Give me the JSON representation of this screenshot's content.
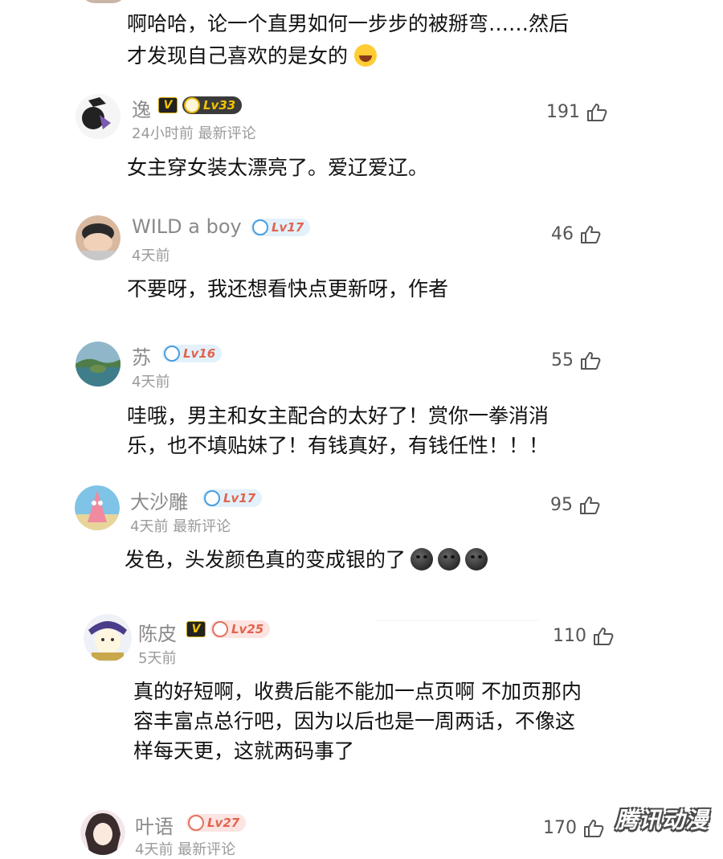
{
  "top_comment": {
    "text_line1": "啊哈哈，论一个直男如何一步步的被掰弯……然后",
    "text_line2": "才发现自己喜欢的是女的",
    "emoji": "laughing-tears-emoji"
  },
  "comments": [
    {
      "name": "逸",
      "vip": "V",
      "level": "Lv33",
      "level_style": "gold",
      "meta": "24小时前 最新评论",
      "likes": "191",
      "text": [
        "女主穿女装太漂亮了。爱辽爱辽。"
      ]
    },
    {
      "name": "WILD a boy",
      "level": "Lv17",
      "level_style": "blue",
      "meta": "4天前",
      "likes": "46",
      "text": [
        "不要呀，我还想看快点更新呀，作者"
      ]
    },
    {
      "name": "苏",
      "level": "Lv16",
      "level_style": "blue",
      "meta": "4天前",
      "likes": "55",
      "text": [
        "哇哦，男主和女主配合的太好了！赏你一拳消消",
        "乐，也不填贴妹了！有钱真好，有钱任性！！！"
      ]
    },
    {
      "name": "大沙雕",
      "level": "Lv17",
      "level_style": "blue",
      "meta": "4天前 最新评论",
      "likes": "95",
      "text": [
        "发色，头发颜色真的变成银的了"
      ],
      "emoji": "new-moon-face-emoji"
    },
    {
      "name": "陈皮",
      "vip": "V",
      "level": "Lv25",
      "level_style": "red",
      "meta": "5天前",
      "likes": "110",
      "text": [
        "真的好短啊，收费后能不能加一点页啊 不加页那内",
        "容丰富点总行吧，因为以后也是一周两话，不像这",
        "样每天更，这就两码事了"
      ]
    },
    {
      "name": "叶语",
      "level": "Lv27",
      "level_style": "red",
      "meta": "4天前 最新评论",
      "likes": "170"
    }
  ],
  "watermark": "腾讯动漫",
  "colors": {
    "name_gray": "#8a8a8a",
    "meta_gray": "#9a9a9a",
    "level_red": "#e2634d",
    "vip_gold": "#f4c400"
  }
}
